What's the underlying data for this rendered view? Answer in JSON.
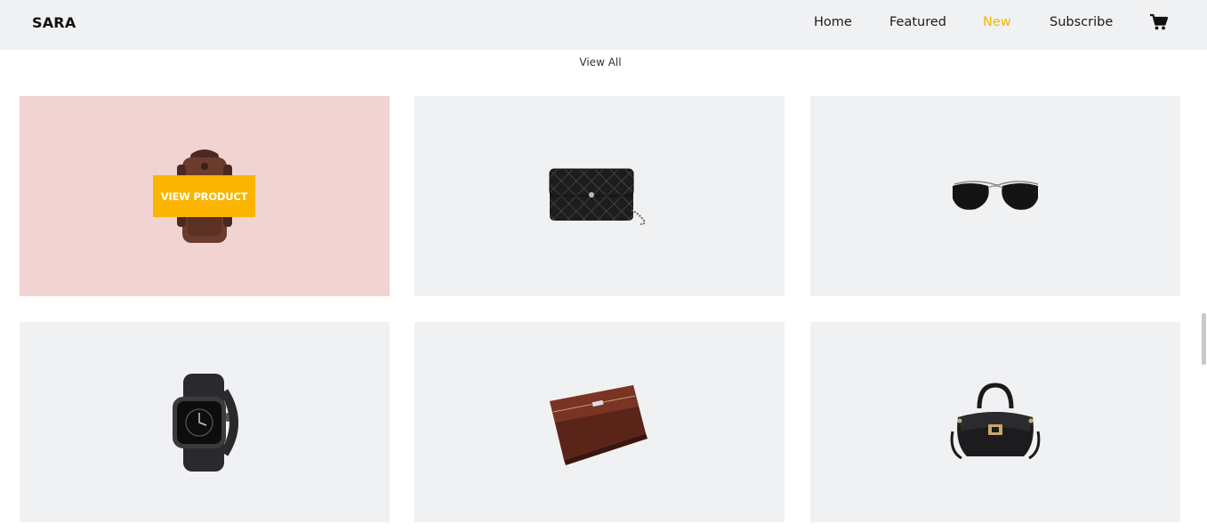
{
  "header": {
    "brand": "SARA",
    "nav": [
      {
        "label": "Home",
        "active": false
      },
      {
        "label": "Featured",
        "active": false
      },
      {
        "label": "New",
        "active": true
      },
      {
        "label": "Subscribe",
        "active": false
      }
    ],
    "cart_icon": "cart-icon"
  },
  "section": {
    "view_all": "View All"
  },
  "products": [
    {
      "name": "backpack",
      "overlay_button": "VIEW PRODUCT",
      "highlighted": true
    },
    {
      "name": "quilted-clutch"
    },
    {
      "name": "aviator-sunglasses"
    },
    {
      "name": "smart-watch"
    },
    {
      "name": "leather-wallet"
    },
    {
      "name": "black-handbag"
    }
  ],
  "colors": {
    "accent": "#f7b500",
    "header_bg": "#f0f1f3",
    "card_bg": "#f0f1f3",
    "card_hover_bg": "#f1d3d2",
    "button_bg": "#fbb400"
  }
}
